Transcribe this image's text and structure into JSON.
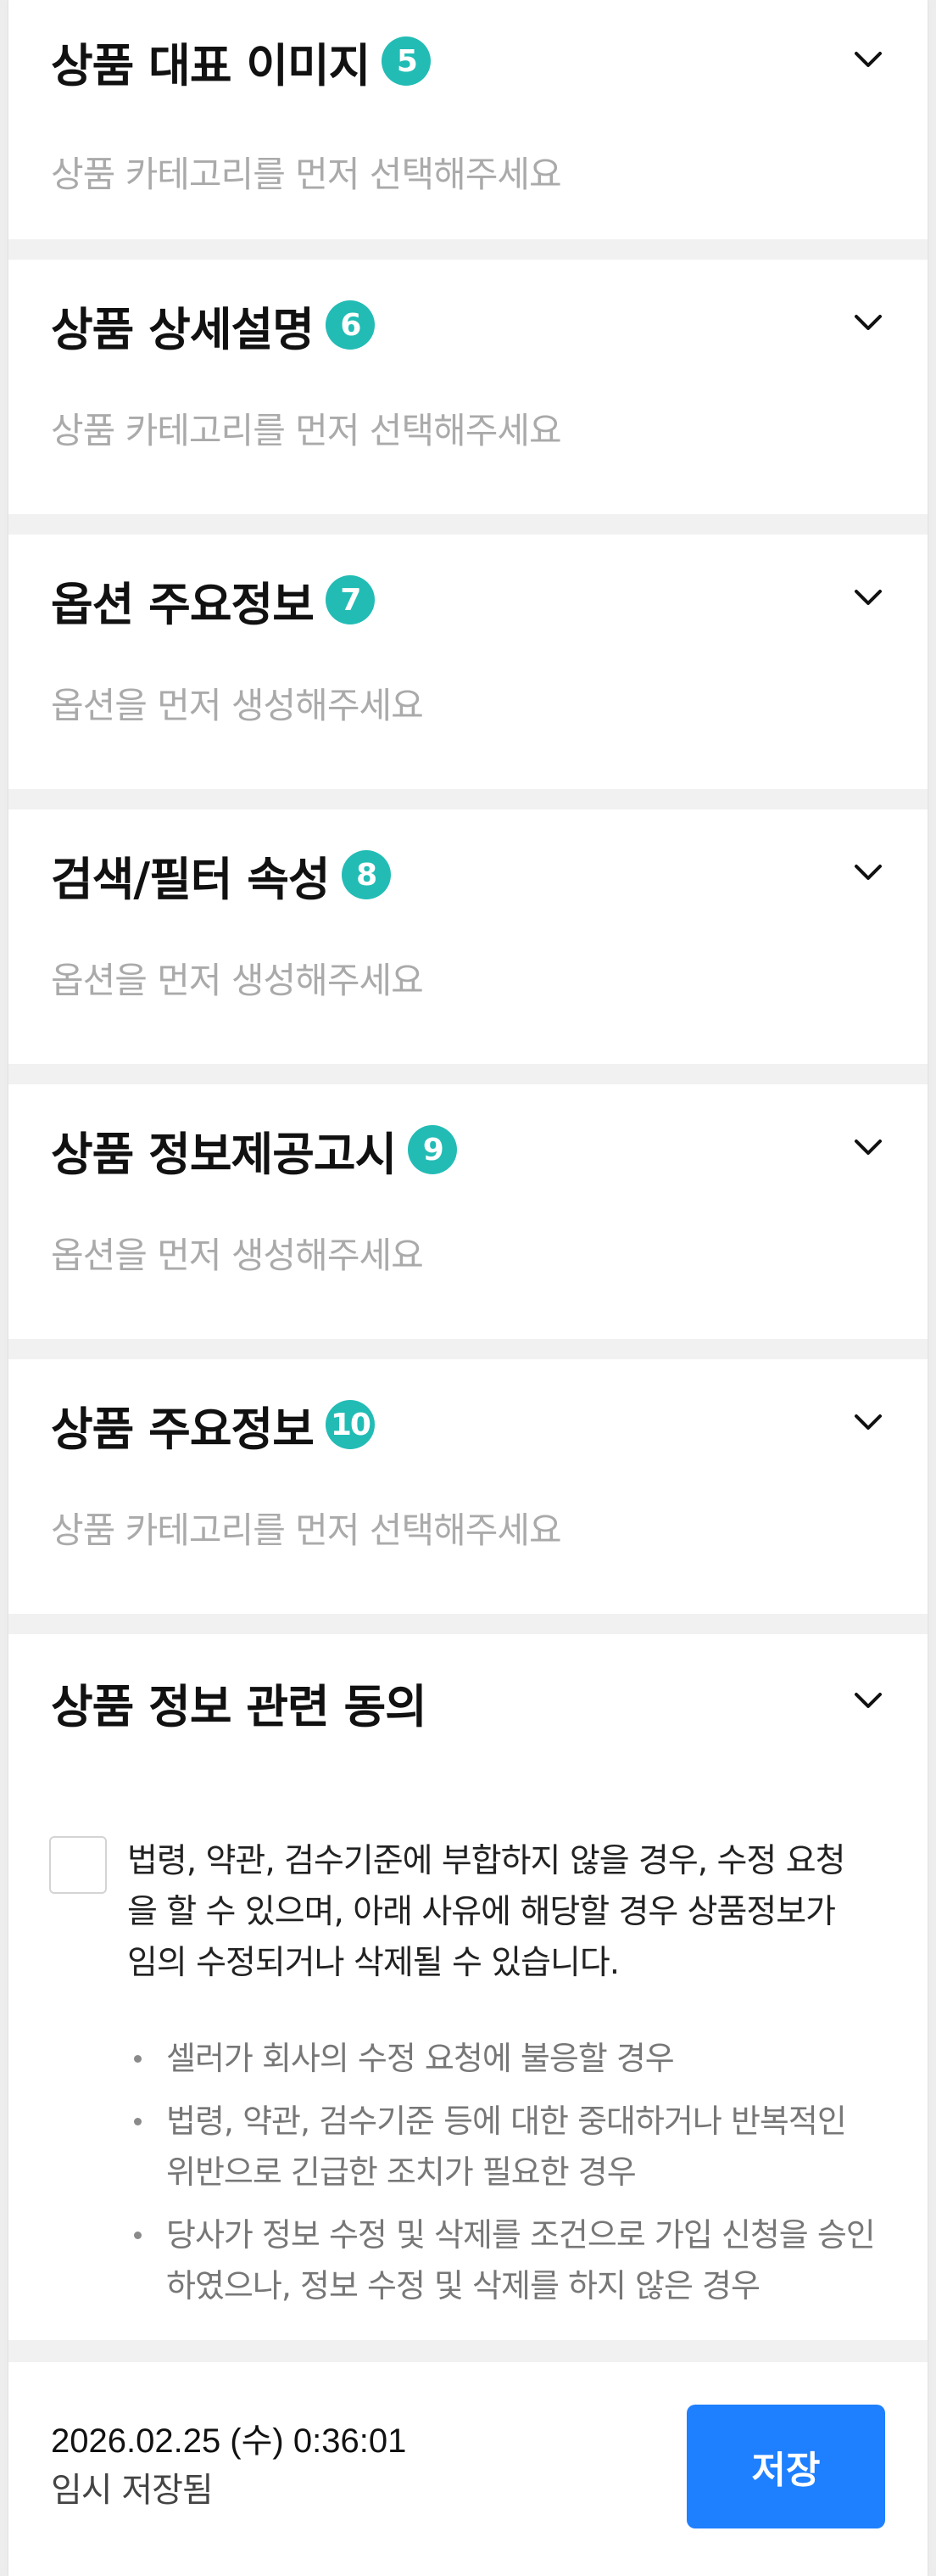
{
  "sections": [
    {
      "title": "상품 대표 이미지",
      "badge": "5",
      "hint": "상품 카테고리를 먼저 선택해주세요"
    },
    {
      "title": "상품 상세설명",
      "badge": "6",
      "hint": "상품 카테고리를 먼저 선택해주세요"
    },
    {
      "title": "옵션 주요정보",
      "badge": "7",
      "hint": "옵션을 먼저 생성해주세요"
    },
    {
      "title": "검색/필터 속성",
      "badge": "8",
      "hint": "옵션을 먼저 생성해주세요"
    },
    {
      "title": "상품 정보제공고시",
      "badge": "9",
      "hint": "옵션을 먼저 생성해주세요"
    },
    {
      "title": "상품 주요정보",
      "badge": "10",
      "hint": "상품 카테고리를 먼저 선택해주세요"
    }
  ],
  "consent": {
    "title": "상품 정보 관련 동의",
    "text": "법령, 약관, 검수기준에 부합하지 않을 경우, 수정 요청을 할 수 있으며, 아래 사유에 해당할 경우 상품정보가 임의 수정되거나 삭제될 수 있습니다.",
    "bullets": [
      "셀러가 회사의 수정 요청에 불응할 경우",
      "법령, 약관, 검수기준 등에 대한 중대하거나 반복적인 위반으로 긴급한 조치가 필요한 경우",
      "당사가 정보 수정 및 삭제를 조건으로 가입 신청을 승인하였으나, 정보 수정 및 삭제를 하지 않은 경우"
    ]
  },
  "footer": {
    "timestamp": "2026.02.25 (수) 0:36:01",
    "status": "임시 저장됨",
    "save_label": "저장"
  },
  "colors": {
    "badge": "#22bcb5",
    "primary_button": "#1e7fff",
    "hint_text": "#aaaaaa"
  },
  "icons": {
    "expand": "chevron-down-icon"
  }
}
